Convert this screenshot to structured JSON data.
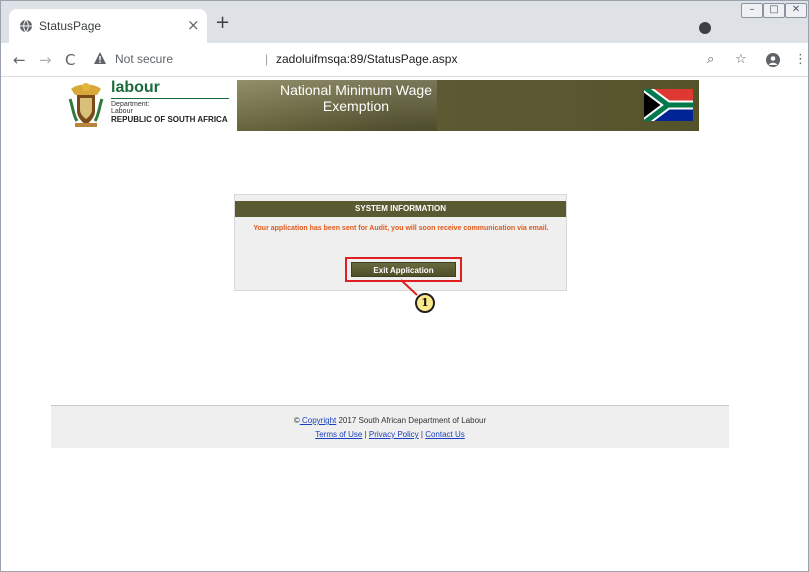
{
  "browser": {
    "tab_title": "StatusPage",
    "tab_close": "×",
    "new_tab": "+",
    "security_label": "Not secure",
    "url": "zadoluifmsqa:89/StatusPage.aspx",
    "window_controls": [
      "–",
      "□",
      "✕"
    ]
  },
  "header": {
    "brand": "labour",
    "dept_line1": "Department:",
    "dept_line2": "Labour",
    "country": "REPUBLIC OF SOUTH AFRICA",
    "banner_line1": "National Minimum Wage",
    "banner_line2": "Exemption"
  },
  "panel": {
    "heading": "SYSTEM INFORMATION",
    "message": "Your application has been sent for Audit, you will soon receive communication via email.",
    "exit_button": "Exit Application"
  },
  "annotation": {
    "callout_number": "1",
    "highlight_color": "#e02020"
  },
  "footer": {
    "copyright_symbol": "©",
    "copyright_link": " Copyright",
    "copyright_text": " 2017 South African Department of Labour",
    "terms": "Terms of Use",
    "privacy": "Privacy Policy",
    "contact": "Contact Us",
    "separator": " | "
  },
  "icons": {
    "back": "back-arrow-icon",
    "forward": "forward-arrow-icon",
    "reload": "reload-icon",
    "warning": "warning-triangle-icon",
    "zoom": "zoom-icon",
    "bookmark": "star-icon",
    "profile": "profile-icon",
    "menu": "kebab-menu-icon"
  }
}
